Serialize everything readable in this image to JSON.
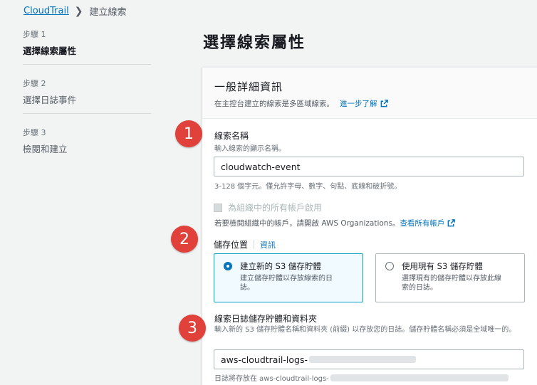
{
  "breadcrumb": {
    "root": "CloudTrail",
    "separator": "❯",
    "current": "建立線索"
  },
  "steps": [
    {
      "number": "步驟 1",
      "label": "選擇線索屬性",
      "active": true
    },
    {
      "number": "步驟 2",
      "label": "選擇日誌事件",
      "active": false
    },
    {
      "number": "步驟 3",
      "label": "檢閱和建立",
      "active": false
    }
  ],
  "page_title": "選擇線索屬性",
  "general": {
    "title": "一般詳細資訊",
    "description": "在主控台建立的線索是多區域線索。",
    "learn_more": "進一步了解"
  },
  "trail_name": {
    "label": "線索名稱",
    "help": "輸入線索的顯示名稱。",
    "value": "cloudwatch-event",
    "constraint": "3-128 個字元。僅允許字母、數字、句點、底線和破折號。"
  },
  "org": {
    "checkbox_label": "為組織中的所有帳戶啟用",
    "help": "若要檢閱組織中的帳戶，請開啟 AWS Organizations。",
    "link": "查看所有帳戶"
  },
  "storage": {
    "label": "儲存位置",
    "info": "資訊",
    "new_bucket": {
      "title": "建立新的 S3 儲存貯體",
      "desc": "建立儲存貯體以存放線索的日誌。"
    },
    "existing_bucket": {
      "title": "使用現有 S3 儲存貯體",
      "desc": "選擇現有的儲存貯體以存放此線索的日誌。"
    }
  },
  "bucket": {
    "label": "線索日誌儲存貯體和資料夾",
    "help": "輸入新的 S3 儲存貯體名稱和資料夾 (前綴) 以存放您的日誌。儲存貯體名稱必須是全域唯一的。",
    "value": "aws-cloudtrail-logs-",
    "path_prefix": "日誌將存放在 aws-cloudtrail-logs-"
  },
  "badges": [
    "1",
    "2",
    "3"
  ],
  "colors": {
    "link": "#0073bb",
    "badge": "#e0413a",
    "selected_border": "#00a1c9",
    "selected_bg": "#f1faff"
  }
}
